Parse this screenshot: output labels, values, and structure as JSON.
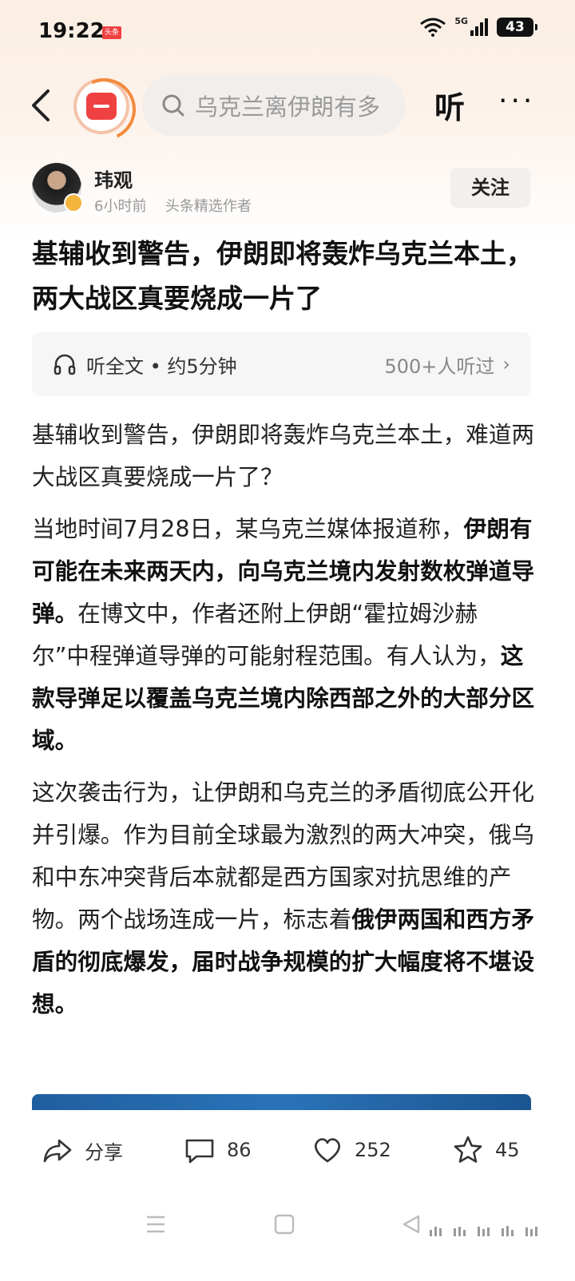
{
  "status_bar": {
    "time": "19:22",
    "app_badge": "头条",
    "network": "5G",
    "battery": "43"
  },
  "nav": {
    "search_placeholder": "乌克兰离伊朗有多",
    "listen_label": "听",
    "more_label": "···"
  },
  "author": {
    "name": "玮观",
    "time_ago": "6小时前",
    "tag": "头条精选作者",
    "follow_label": "关注"
  },
  "article": {
    "title": "基辅收到警告，伊朗即将轰炸乌克兰本土，两大战区真要烧成一片了",
    "listen_bar": {
      "label": "听全文 • 约5分钟",
      "count": "500+人听过"
    },
    "p1": "基辅收到警告，伊朗即将轰炸乌克兰本土，难道两大战区真要烧成一片了？",
    "p2_a": "当地时间7月28日，某乌克兰媒体报道称，",
    "p2_b": "伊朗有可能在未来两天内，向乌克兰境内发射数枚弹道导弹。",
    "p2_c": "在博文中，作者还附上伊朗“霍拉姆沙赫尔”中程弹道导弹的可能射程范围。有人认为，",
    "p2_d": "这款导弹足以覆盖乌克兰境内除西部之外的大部分区域。",
    "p3_a": "这次袭击行为，让伊朗和乌克兰的矛盾彻底公开化并引爆。作为目前全球最为激烈的两大冲突，俄乌和中东冲突背后本就都是西方国家对抗思维的产物。两个战场连成一片，标志着",
    "p3_b": "俄伊两国和西方矛盾的彻底爆发，届时战争规模的扩大幅度将不堪设想。"
  },
  "actions": {
    "share_label": "分享",
    "comments": "86",
    "likes": "252",
    "favorites": "45"
  },
  "colors": {
    "brand_red": "#f04142",
    "accent_orange": "#f28b3c"
  }
}
